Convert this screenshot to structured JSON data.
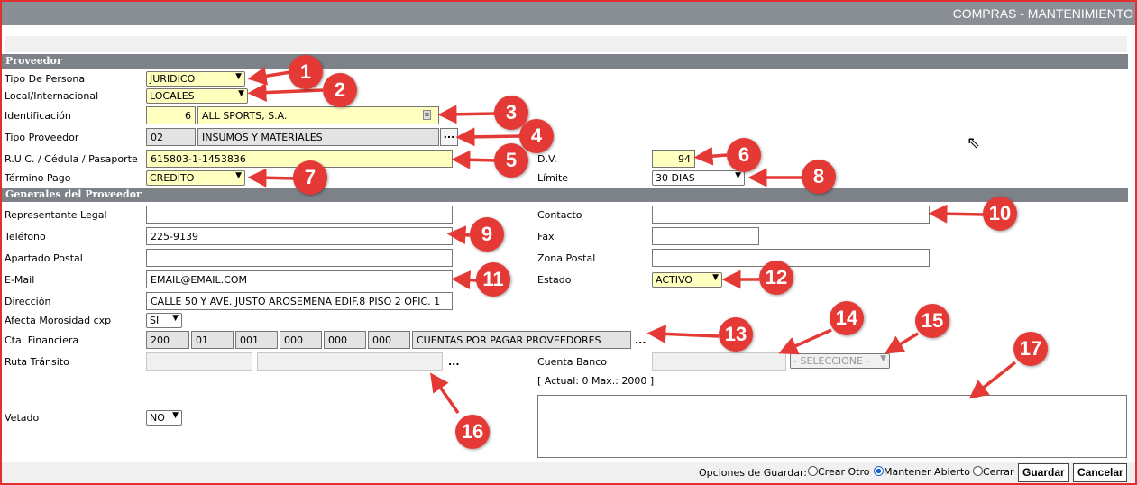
{
  "window": {
    "title": "COMPRAS - MANTENIMIENTO"
  },
  "sections": {
    "proveedor": "Proveedor",
    "generales": "Generales del Proveedor"
  },
  "proveedor": {
    "tipo_persona": {
      "label": "Tipo De Persona",
      "value": "JURIDICO"
    },
    "local_internacional": {
      "label": "Local/Internacional",
      "value": "LOCALES"
    },
    "identificacion": {
      "label": "Identificación",
      "code": "6",
      "name": "ALL SPORTS, S.A."
    },
    "tipo_proveedor": {
      "label": "Tipo Proveedor",
      "code": "02",
      "name": "INSUMOS Y MATERIALES",
      "button": "..."
    },
    "ruc": {
      "label": "R.U.C. / Cédula / Pasaporte",
      "value": "615803-1-1453836"
    },
    "dv": {
      "label": "D.V.",
      "value": "94"
    },
    "termino_pago": {
      "label": "Término Pago",
      "value": "CREDITO"
    },
    "limite": {
      "label": "Límite",
      "value": "30 DIAS"
    }
  },
  "generales": {
    "representante": {
      "label": "Representante Legal",
      "value": ""
    },
    "contacto": {
      "label": "Contacto",
      "value": ""
    },
    "telefono": {
      "label": "Teléfono",
      "value": "225-9139"
    },
    "fax": {
      "label": "Fax",
      "value": ""
    },
    "apartado": {
      "label": "Apartado Postal",
      "value": ""
    },
    "zona_postal": {
      "label": "Zona Postal",
      "value": ""
    },
    "email": {
      "label": "E-Mail",
      "value": "EMAIL@EMAIL.COM"
    },
    "estado": {
      "label": "Estado",
      "value": "ACTIVO"
    },
    "direccion": {
      "label": "Dirección",
      "value": "CALLE 50 Y AVE. JUSTO AROSEMENA EDIF.8 PISO 2 OFIC. 1"
    },
    "morosidad": {
      "label": "Afecta Morosidad cxp",
      "value": "SI"
    },
    "cta_financiera": {
      "label": "Cta. Financiera",
      "segments": [
        "200",
        "01",
        "001",
        "000",
        "000",
        "000"
      ],
      "name": "CUENTAS POR PAGAR  PROVEEDORES",
      "button": "..."
    },
    "ruta_transito": {
      "label": "Ruta Tránsito",
      "button": "..."
    },
    "cuenta_banco": {
      "label": "Cuenta Banco",
      "select": "- SELECCIONE -"
    },
    "counter": "[ Actual: 0   Max.: 2000 ]",
    "vetado": {
      "label": "Vetado",
      "value": "NO"
    }
  },
  "footer": {
    "opciones_label": "Opciones de Guardar:",
    "options": [
      "Crear Otro",
      "Mantener Abierto",
      "Cerrar"
    ],
    "selected": "Mantener Abierto",
    "guardar": "Guardar",
    "cancelar": "Cancelar"
  },
  "annotations": [
    "1",
    "2",
    "3",
    "4",
    "5",
    "6",
    "7",
    "8",
    "9",
    "10",
    "11",
    "12",
    "13",
    "14",
    "15",
    "16",
    "17"
  ],
  "colors": {
    "badge": "#e53935",
    "section": "#7d8289",
    "highlight": "#ffffc0"
  }
}
